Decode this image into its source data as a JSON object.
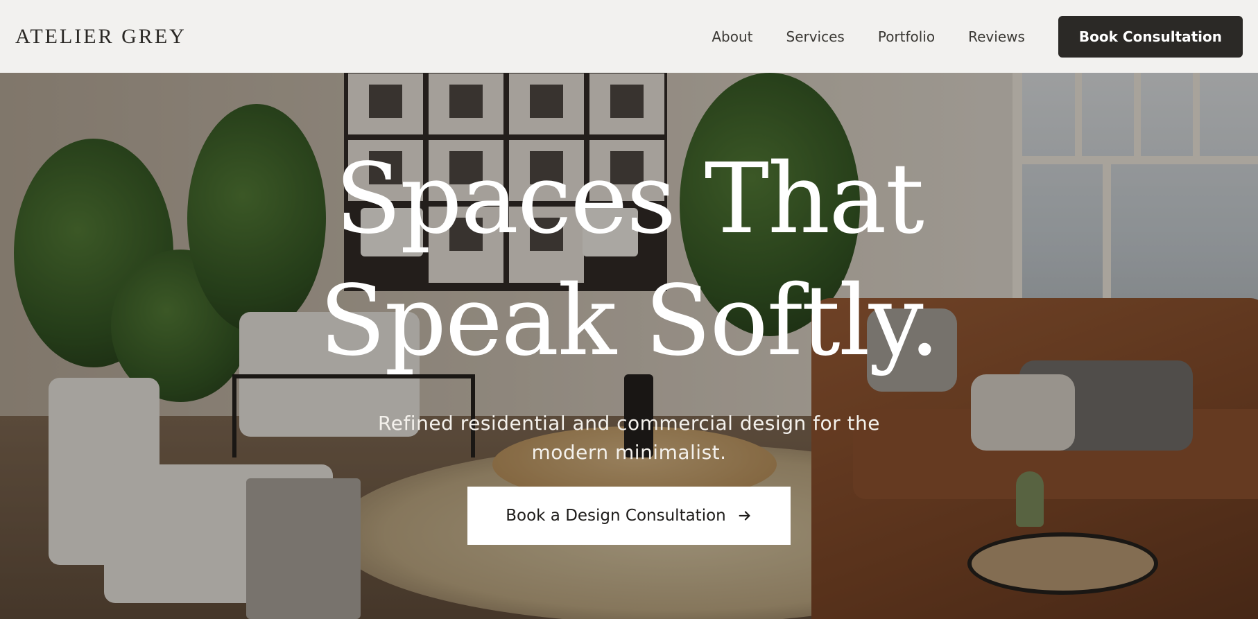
{
  "header": {
    "logo": "ATELIER GREY",
    "nav": [
      {
        "label": "About"
      },
      {
        "label": "Services"
      },
      {
        "label": "Portfolio"
      },
      {
        "label": "Reviews"
      }
    ],
    "cta_label": "Book Consultation"
  },
  "hero": {
    "headline_line1": "Spaces That",
    "headline_line2": "Speak Softly.",
    "subheadline": "Refined residential and commercial design for the modern minimalist.",
    "cta_label": "Book a Design Consultation",
    "cta_icon": "arrow-right-icon",
    "background_image": "living-room-interior"
  },
  "colors": {
    "header_bg": "#f2f1ef",
    "header_cta_bg": "#2b2926",
    "hero_text": "#ffffff",
    "hero_cta_bg": "#ffffff"
  }
}
